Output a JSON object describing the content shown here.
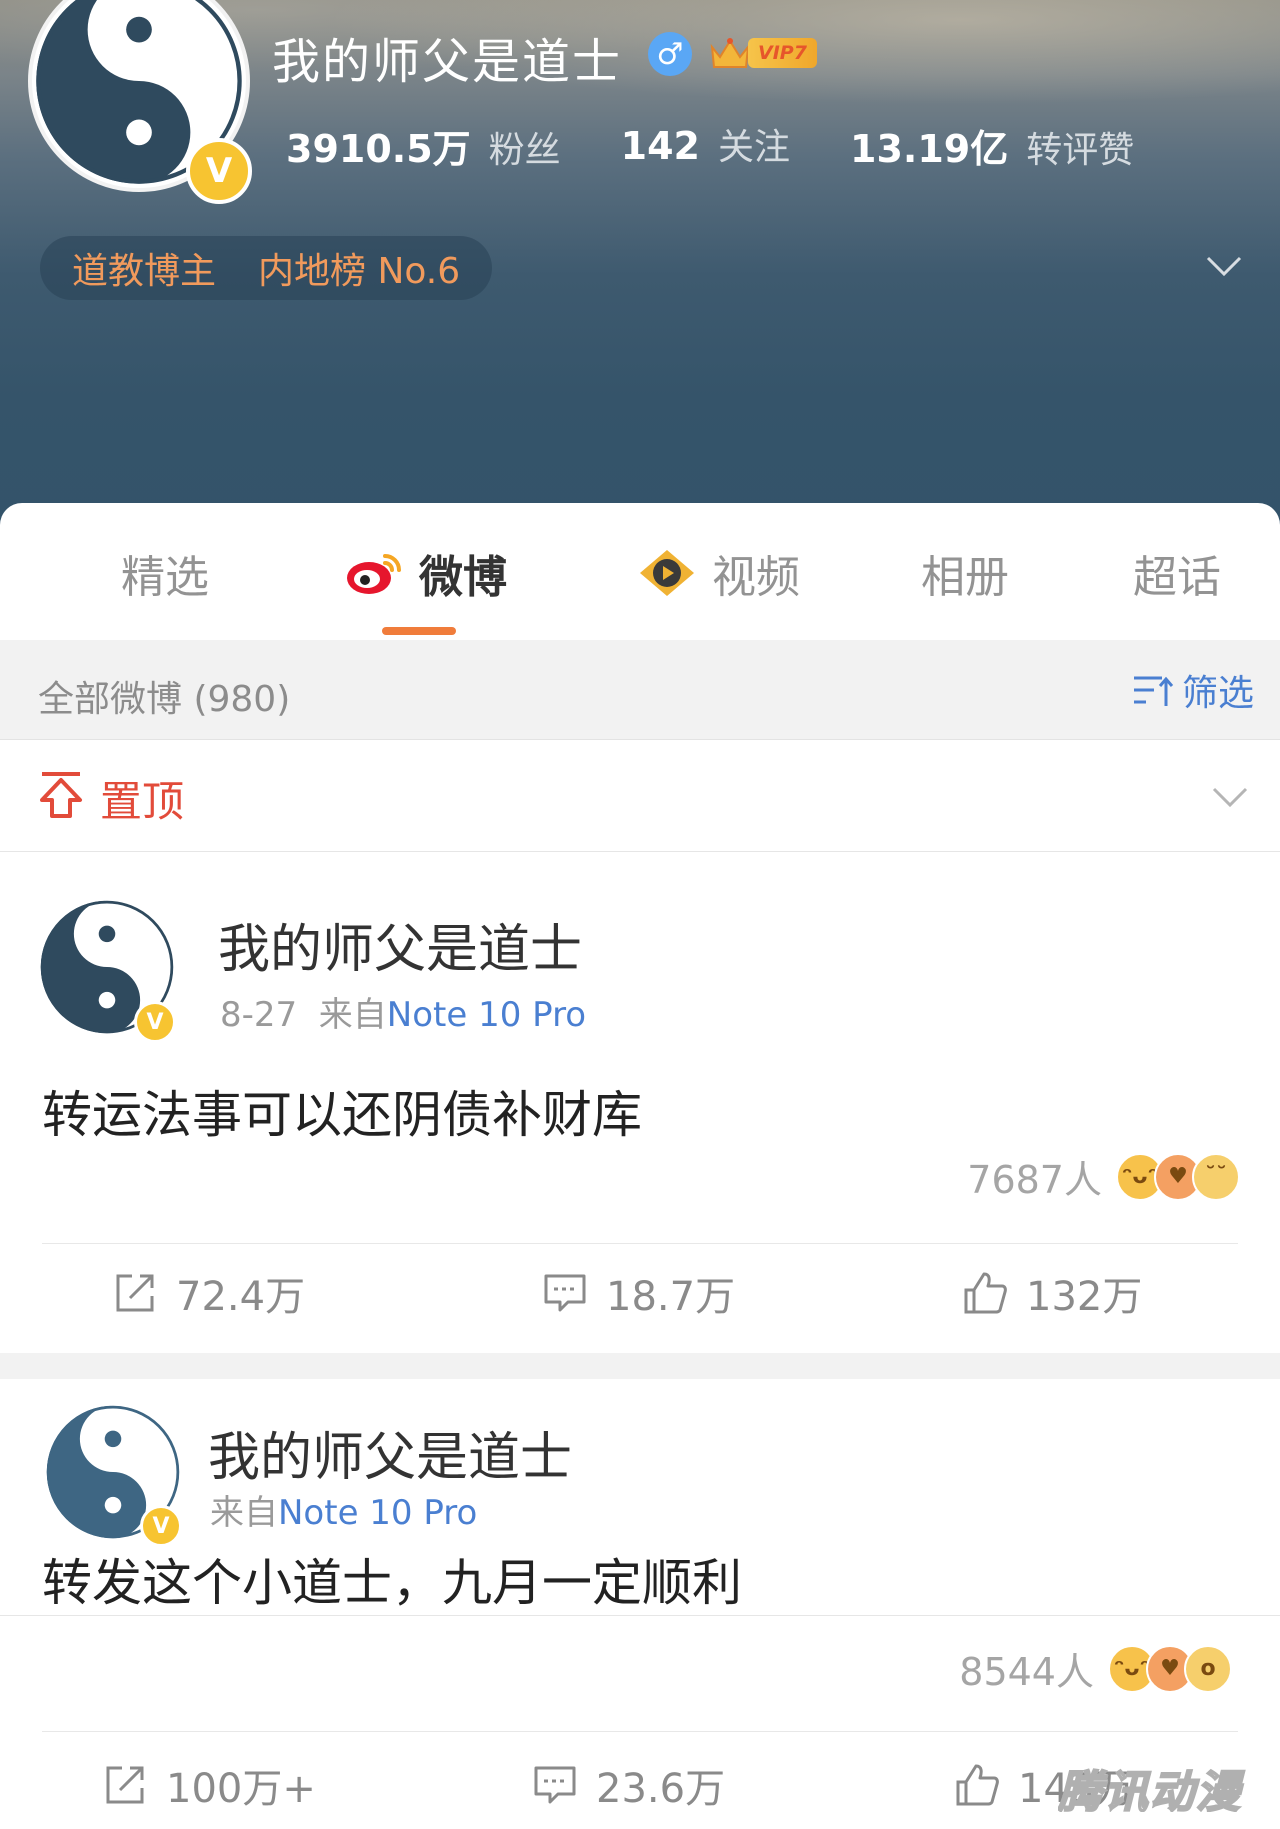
{
  "profile": {
    "name": "我的师父是道士",
    "gender_symbol": "♂",
    "verified_badge": "V",
    "vip_label": "VIP7",
    "stats": [
      {
        "value": "3910.5万",
        "label": "粉丝"
      },
      {
        "value": "142",
        "label": "关注"
      },
      {
        "value": "13.19亿",
        "label": "转评赞"
      }
    ],
    "tags": [
      "道教博主",
      "内地榜 No.6"
    ]
  },
  "tabs": [
    {
      "label": "精选",
      "icon": null
    },
    {
      "label": "微博",
      "icon": "weibo-logo-icon",
      "active": true
    },
    {
      "label": "视频",
      "icon": "video-play-icon"
    },
    {
      "label": "相册",
      "icon": null
    },
    {
      "label": "超话",
      "icon": null
    }
  ],
  "filter": {
    "title": "全部微博 (980)",
    "button_label": "筛选"
  },
  "pinned": {
    "label": "置顶"
  },
  "posts": [
    {
      "author": "我的师父是道士",
      "date": "8-27",
      "source_prefix": "来自",
      "source": "Note 10 Pro",
      "text": "转运法事可以还阴债补财库",
      "reaction_count": "7687人",
      "emoji_icons": [
        "laugh-emoji-icon",
        "love-emoji-icon",
        "sleepy-emoji-icon"
      ],
      "reposts": "72.4万",
      "comments": "18.7万",
      "likes": "132万"
    },
    {
      "author": "我的师父是道士",
      "date": "",
      "source_prefix": "来自",
      "source": "Note 10 Pro",
      "text": "转发这个小道士，九月一定顺利",
      "reaction_count": "8544人",
      "emoji_icons": [
        "laugh-emoji-icon",
        "love-emoji-icon",
        "surprised-emoji-icon"
      ],
      "reposts": "100万+",
      "comments": "23.6万",
      "likes": "143万"
    }
  ],
  "watermark": "腾讯动漫",
  "colors": {
    "accent_orange": "#f07c3b",
    "link_blue": "#4a7fd1",
    "pin_red": "#e24b3a",
    "tag_orange": "#f19a5c",
    "verified_gold": "#f7c431"
  }
}
